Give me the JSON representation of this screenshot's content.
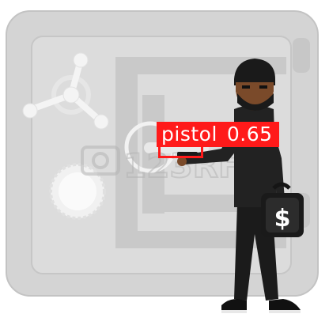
{
  "scene": {
    "subject": "masked-thief-with-money-bag",
    "background": "bank-vault-door",
    "watermark": "123RF",
    "bag_symbol": "$",
    "colors": {
      "vault": "#d6d6d6",
      "vault_shade": "#c4c4c4",
      "vault_highlight": "#ebebeb",
      "vault_outline": "#b9b9b9",
      "clothing": "#1c1c1c",
      "skin": "#7a4a2a",
      "watermark": "#b5b5b5"
    }
  },
  "detection": {
    "label": "pistol",
    "score": "0.65",
    "box_color": "#ff1a1a",
    "text_color": "#ffffff"
  }
}
